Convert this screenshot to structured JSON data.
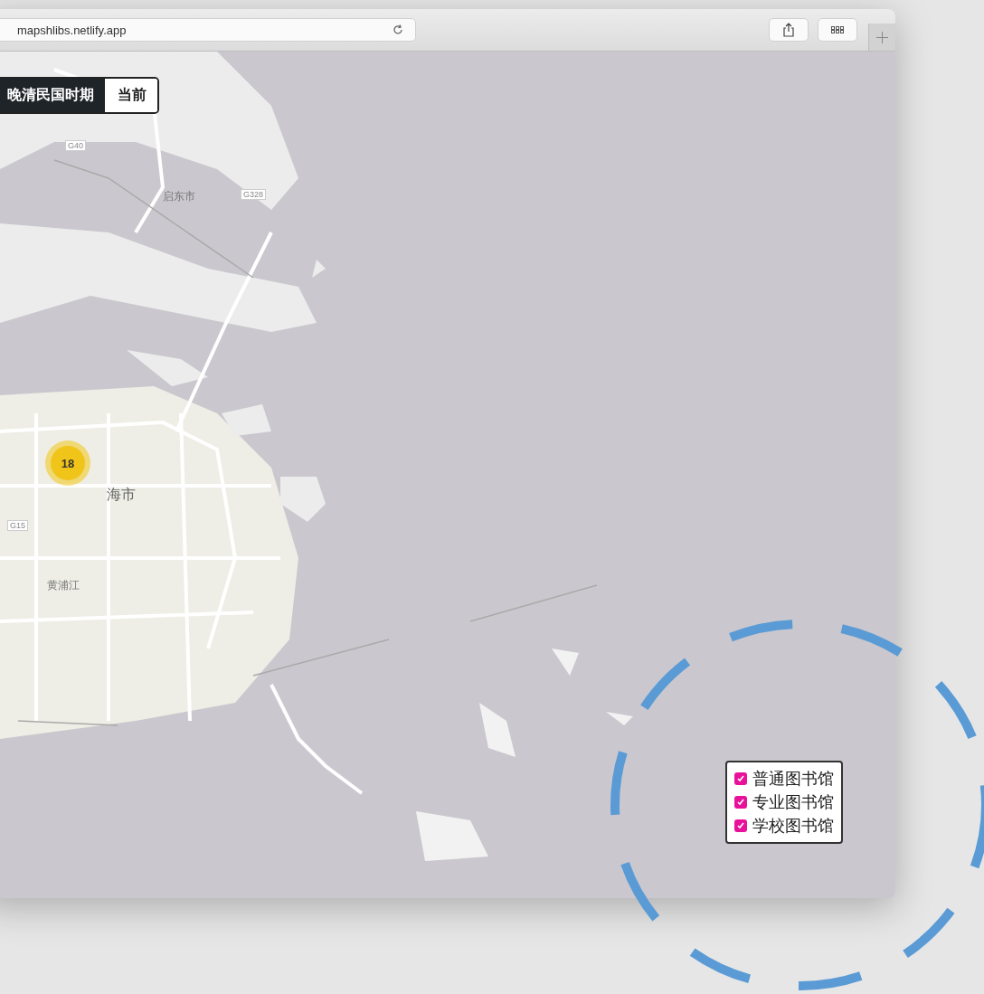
{
  "browser": {
    "url": "mapshlibs.netlify.app"
  },
  "period_toggle": [
    {
      "label": "晚清民国时期",
      "selected": true
    },
    {
      "label": "当前",
      "selected": false
    }
  ],
  "map_labels": [
    {
      "text": "G40",
      "kind": "shield"
    },
    {
      "text": "启东市",
      "kind": "place"
    },
    {
      "text": "G328",
      "kind": "shield"
    },
    {
      "text": "海市",
      "kind": "place"
    },
    {
      "text": "G15",
      "kind": "shield"
    },
    {
      "text": "黄浦江",
      "kind": "place"
    }
  ],
  "cluster": {
    "count": "18"
  },
  "legend": [
    {
      "label": "普通图书馆",
      "checked": true,
      "color": "#e8129a"
    },
    {
      "label": "专业图书馆",
      "checked": true,
      "color": "#e8129a"
    },
    {
      "label": "学校图书馆",
      "checked": true,
      "color": "#e8129a"
    }
  ]
}
